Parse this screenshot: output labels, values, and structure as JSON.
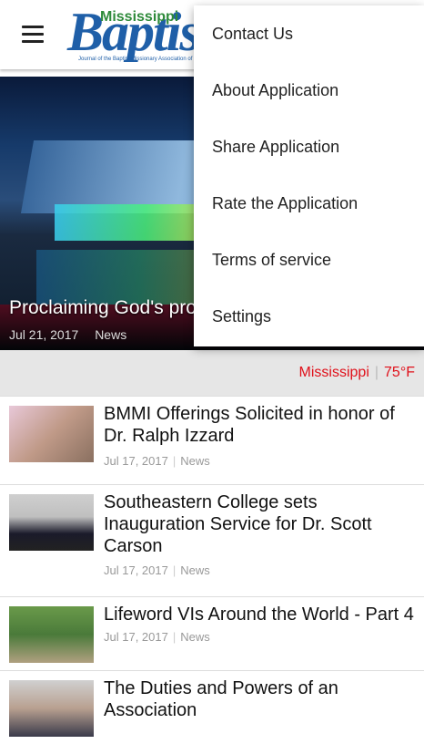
{
  "appbar": {
    "logo_small": "Mississippi",
    "logo_big": "Baptist",
    "logo_sub": "Journal of the Baptist Missionary Association of Mississippi"
  },
  "hero": {
    "title": "Proclaiming God's promises",
    "date": "Jul 21, 2017",
    "category": "News"
  },
  "weather": {
    "location": "Mississippi",
    "temp": "75°F"
  },
  "articles": [
    {
      "title": "BMMI Offerings Solicited in honor of Dr. Ralph Izzard",
      "date": "Jul 17, 2017",
      "category": "News"
    },
    {
      "title": "Southeastern College sets Inauguration Service for Dr. Scott Carson",
      "date": "Jul 17, 2017",
      "category": "News"
    },
    {
      "title": "Lifeword VIs Around the World - Part 4",
      "date": "Jul 17, 2017",
      "category": "News"
    },
    {
      "title": "The Duties and Powers of an Association",
      "date": "",
      "category": ""
    }
  ],
  "menu": {
    "items": [
      "Contact Us",
      "About Application",
      "Share Application",
      "Rate the Application",
      "Terms of service",
      "Settings"
    ]
  },
  "colors": {
    "accent": "#e0101a",
    "logo_blue": "#1f5fa8",
    "logo_green": "#2e8a3a"
  },
  "icons": {
    "menu": "hamburger-icon"
  }
}
